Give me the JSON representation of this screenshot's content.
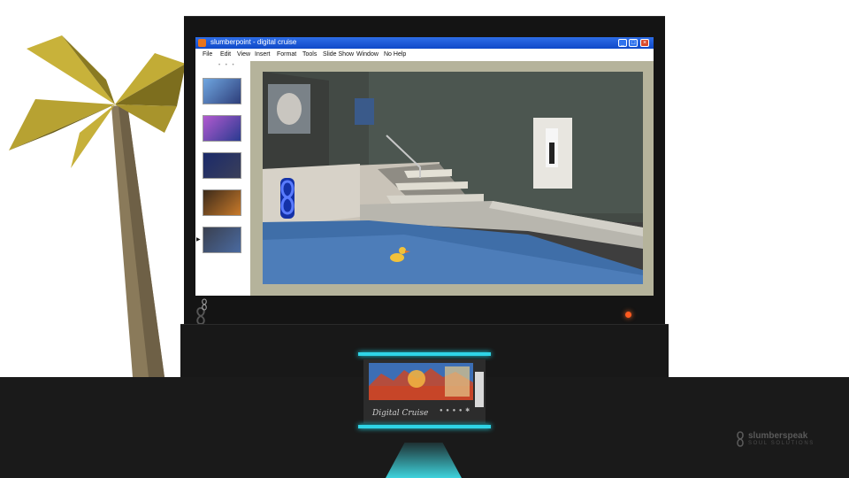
{
  "window": {
    "title": "slumberpoint - digital cruise"
  },
  "menu": [
    {
      "label": "File"
    },
    {
      "label": "Edit"
    },
    {
      "label": "View"
    },
    {
      "label": "Insert"
    },
    {
      "label": "Format"
    },
    {
      "label": "Tools"
    },
    {
      "label": "Slide Show"
    },
    {
      "label": "Window"
    },
    {
      "label": "No Help"
    }
  ],
  "slides": {
    "count": 5,
    "current_index": 5
  },
  "deck": {
    "cassette_label": "Digital Cruise"
  },
  "brand": {
    "name": "slumberspeak",
    "tagline": "SOUL SOLUTIONS"
  },
  "colors": {
    "titlebar": "#0f49c8",
    "accent_neon": "#2fd4e6",
    "power_led": "#ff5a1f"
  }
}
